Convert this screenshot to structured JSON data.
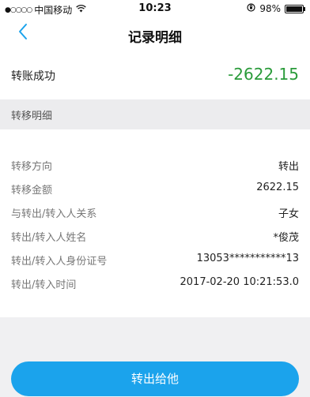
{
  "status_bar": {
    "signal": "●○○○○",
    "carrier": "中国移动",
    "time": "10:23",
    "battery_text": "98%",
    "battery_level": 0.98
  },
  "nav": {
    "title": "记录明细"
  },
  "summary": {
    "label": "转账成功",
    "amount": "-2622.15",
    "amount_color": "#2a9b3a"
  },
  "section": {
    "title": "转移明细"
  },
  "details": [
    {
      "key": "转移方向",
      "value": "转出"
    },
    {
      "key": "转移金额",
      "value": "2622.15"
    },
    {
      "key": "与转出/转入人关系",
      "value": "子女"
    },
    {
      "key": "转出/转入人姓名",
      "value": "*俊茂"
    },
    {
      "key": "转出/转入人身份证号",
      "value": "13053***********13"
    },
    {
      "key": "转出/转入时间",
      "value": "2017-02-20 10:21:53.0"
    }
  ],
  "action": {
    "button_label": "转出给他",
    "color": "#1ba3ec"
  }
}
